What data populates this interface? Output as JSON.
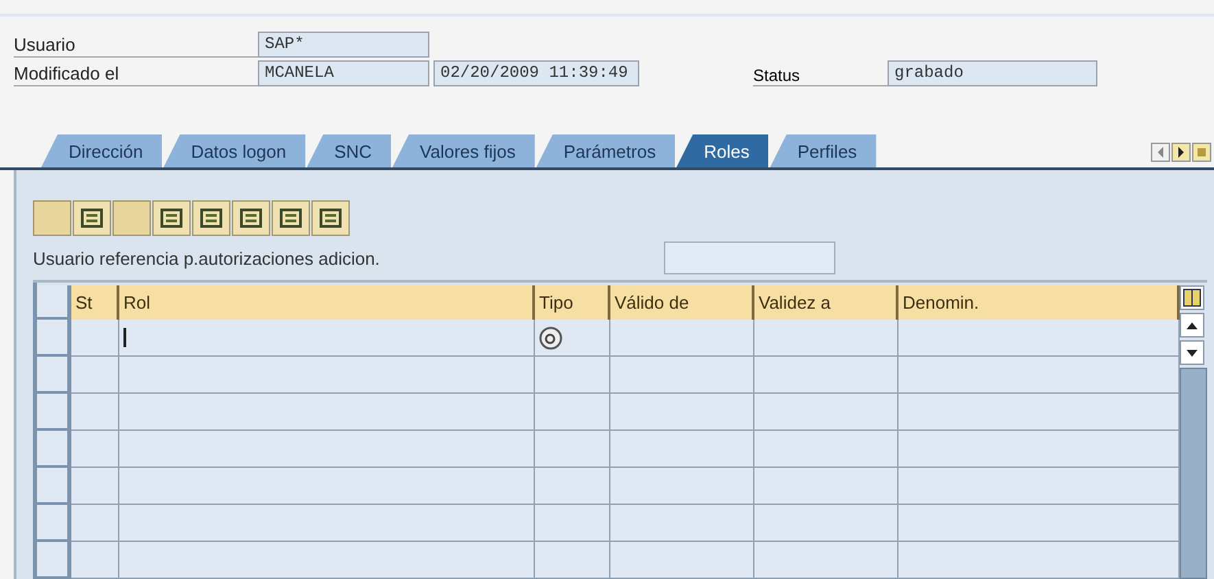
{
  "header": {
    "fields": [
      {
        "label": "Usuario",
        "values": [
          "SAP*"
        ]
      },
      {
        "label": "Modificado el",
        "values": [
          "MCANELA",
          "02/20/2009 11:39:49"
        ],
        "status_label": "Status",
        "status_value": "grabado"
      }
    ]
  },
  "tabs": [
    {
      "label": "Dirección",
      "selected": false
    },
    {
      "label": "Datos logon",
      "selected": false
    },
    {
      "label": "SNC",
      "selected": false
    },
    {
      "label": "Valores fijos",
      "selected": false
    },
    {
      "label": "Parámetros",
      "selected": false
    },
    {
      "label": "Roles",
      "selected": true
    },
    {
      "label": "Perfiles",
      "selected": false
    }
  ],
  "toolbar": [
    {
      "disabled": true
    },
    {
      "disabled": false
    },
    {
      "disabled": true
    },
    {
      "disabled": false
    },
    {
      "disabled": false
    },
    {
      "disabled": false
    },
    {
      "disabled": false
    },
    {
      "disabled": false
    }
  ],
  "reference_label": "Usuario referencia p.autorizaciones adicion.",
  "table": {
    "columns": [
      "St",
      "Rol",
      "Tipo",
      "Válido de",
      "Validez a",
      "Denomin."
    ],
    "rows": [
      {
        "kind": "entry"
      },
      {
        "kind": "empty"
      },
      {
        "kind": "empty"
      },
      {
        "kind": "empty"
      },
      {
        "kind": "empty"
      },
      {
        "kind": "empty"
      },
      {
        "kind": "empty"
      }
    ]
  }
}
